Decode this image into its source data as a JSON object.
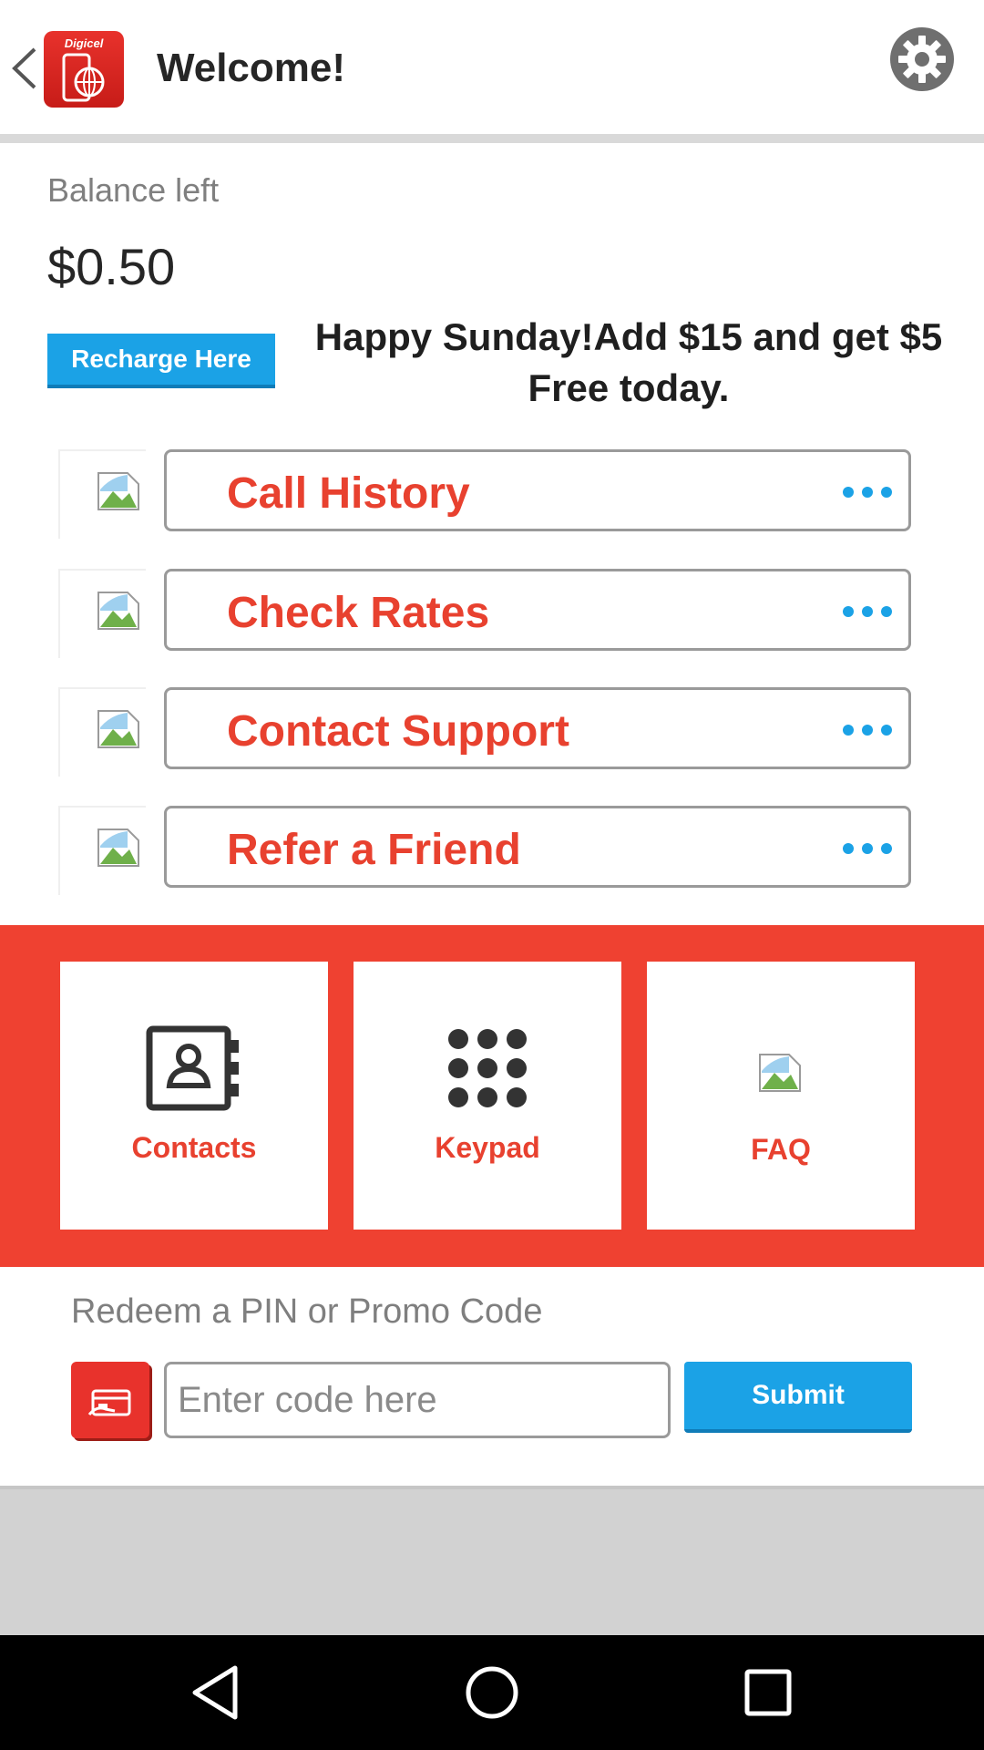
{
  "header": {
    "logo_text": "Digicel",
    "title": "Welcome!"
  },
  "balance": {
    "label": "Balance left",
    "value": "$0.50"
  },
  "promo": {
    "recharge_label": "Recharge Here",
    "text": "Happy Sunday!Add $15 and get $5 Free today."
  },
  "menu": {
    "items": [
      {
        "label": "Call History"
      },
      {
        "label": "Check Rates"
      },
      {
        "label": "Contact Support"
      },
      {
        "label": "Refer a Friend"
      }
    ]
  },
  "tiles": {
    "items": [
      {
        "label": "Contacts",
        "icon": "contacts-book-icon"
      },
      {
        "label": "Keypad",
        "icon": "keypad-icon"
      },
      {
        "label": "FAQ",
        "icon": "broken-image-icon"
      }
    ]
  },
  "redeem": {
    "label": "Redeem a PIN or Promo Code",
    "placeholder": "Enter code here",
    "submit_label": "Submit"
  },
  "colors": {
    "accent_red": "#ef4131",
    "accent_blue": "#1ba2e6",
    "text_dark": "#262626",
    "text_grey": "#7f7f7f"
  }
}
